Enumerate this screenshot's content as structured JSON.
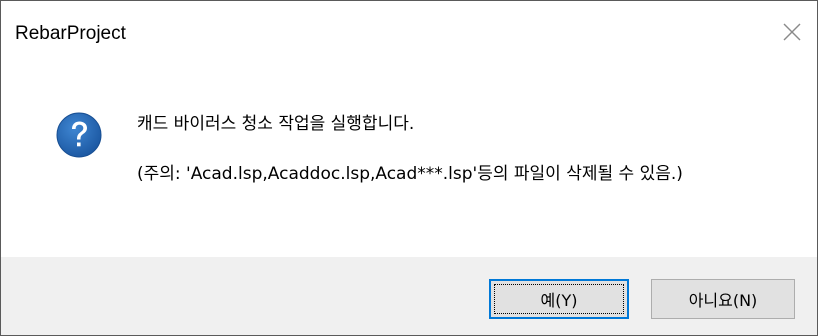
{
  "window": {
    "title": "RebarProject"
  },
  "icons": {
    "close": "close-icon",
    "question": "question-icon"
  },
  "message": {
    "line1": "캐드 바이러스 청소 작업을 실행합니다.",
    "line2": "(주의: 'Acad.lsp,Acaddoc.lsp,Acad***.lsp'등의 파일이 삭제될 수 있음.)"
  },
  "buttons": {
    "yes_label": "예(Y)",
    "no_label": "아니요(N)"
  },
  "colors": {
    "accent": "#0078d7",
    "question_icon": "#1f5fa8",
    "footer_bg": "#f0f0f0"
  }
}
